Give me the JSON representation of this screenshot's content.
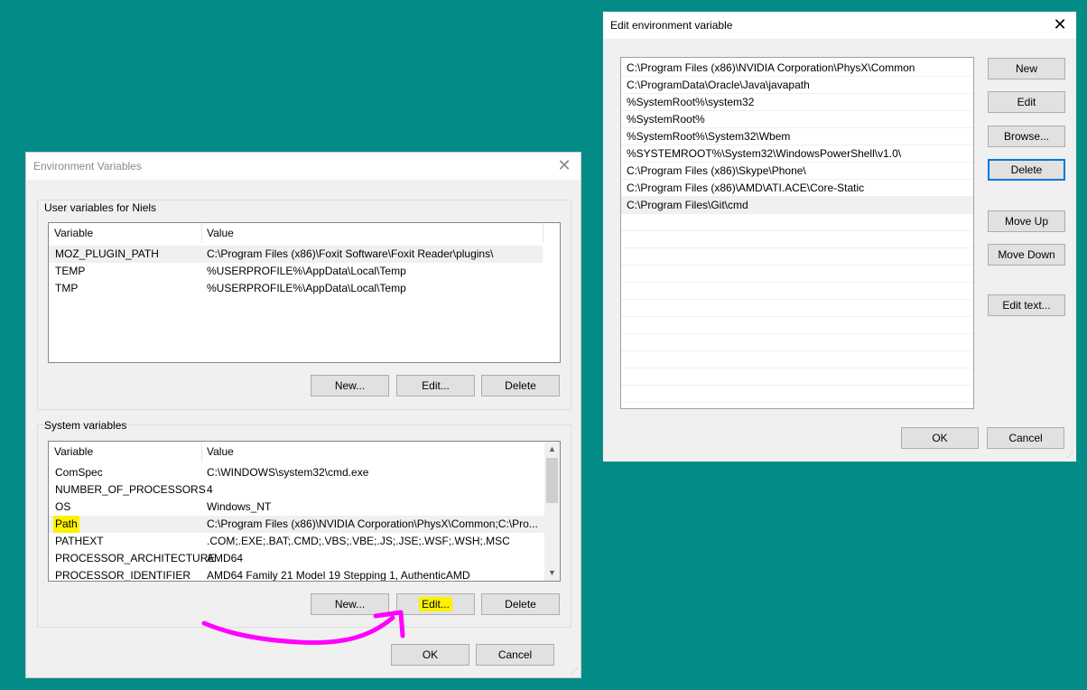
{
  "env_dialog": {
    "title": "Environment Variables",
    "user_group_label": "User variables for Niels",
    "columns": {
      "variable": "Variable",
      "value": "Value"
    },
    "user_vars": [
      {
        "name": "MOZ_PLUGIN_PATH",
        "value": "C:\\Program Files (x86)\\Foxit Software\\Foxit Reader\\plugins\\"
      },
      {
        "name": "TEMP",
        "value": "%USERPROFILE%\\AppData\\Local\\Temp"
      },
      {
        "name": "TMP",
        "value": "%USERPROFILE%\\AppData\\Local\\Temp"
      }
    ],
    "user_buttons": {
      "new": "New...",
      "edit": "Edit...",
      "delete": "Delete"
    },
    "system_group_label": "System variables",
    "system_vars": [
      {
        "name": "ComSpec",
        "value": "C:\\WINDOWS\\system32\\cmd.exe"
      },
      {
        "name": "NUMBER_OF_PROCESSORS",
        "value": "4"
      },
      {
        "name": "OS",
        "value": "Windows_NT"
      },
      {
        "name": "Path",
        "value": "C:\\Program Files (x86)\\NVIDIA Corporation\\PhysX\\Common;C:\\Pro..."
      },
      {
        "name": "PATHEXT",
        "value": ".COM;.EXE;.BAT;.CMD;.VBS;.VBE;.JS;.JSE;.WSF;.WSH;.MSC"
      },
      {
        "name": "PROCESSOR_ARCHITECTURE",
        "value": "AMD64"
      },
      {
        "name": "PROCESSOR_IDENTIFIER",
        "value": "AMD64 Family 21 Model 19 Stepping 1, AuthenticAMD"
      }
    ],
    "system_buttons": {
      "new": "New...",
      "edit": "Edit...",
      "delete": "Delete"
    },
    "ok": "OK",
    "cancel": "Cancel"
  },
  "edit_dialog": {
    "title": "Edit environment variable",
    "entries": [
      "C:\\Program Files (x86)\\NVIDIA Corporation\\PhysX\\Common",
      "C:\\ProgramData\\Oracle\\Java\\javapath",
      "%SystemRoot%\\system32",
      "%SystemRoot%",
      "%SystemRoot%\\System32\\Wbem",
      "%SYSTEMROOT%\\System32\\WindowsPowerShell\\v1.0\\",
      "C:\\Program Files (x86)\\Skype\\Phone\\",
      "C:\\Program Files (x86)\\AMD\\ATI.ACE\\Core-Static",
      "C:\\Program Files\\Git\\cmd"
    ],
    "buttons": {
      "new": "New",
      "edit": "Edit",
      "browse": "Browse...",
      "delete": "Delete",
      "move_up": "Move Up",
      "move_down": "Move Down",
      "edit_text": "Edit text..."
    },
    "ok": "OK",
    "cancel": "Cancel"
  },
  "colors": {
    "desktop": "#028b87",
    "highlight": "#fcf200",
    "annotation_arrow": "#ff00ff",
    "focus_border": "#0078d7"
  }
}
